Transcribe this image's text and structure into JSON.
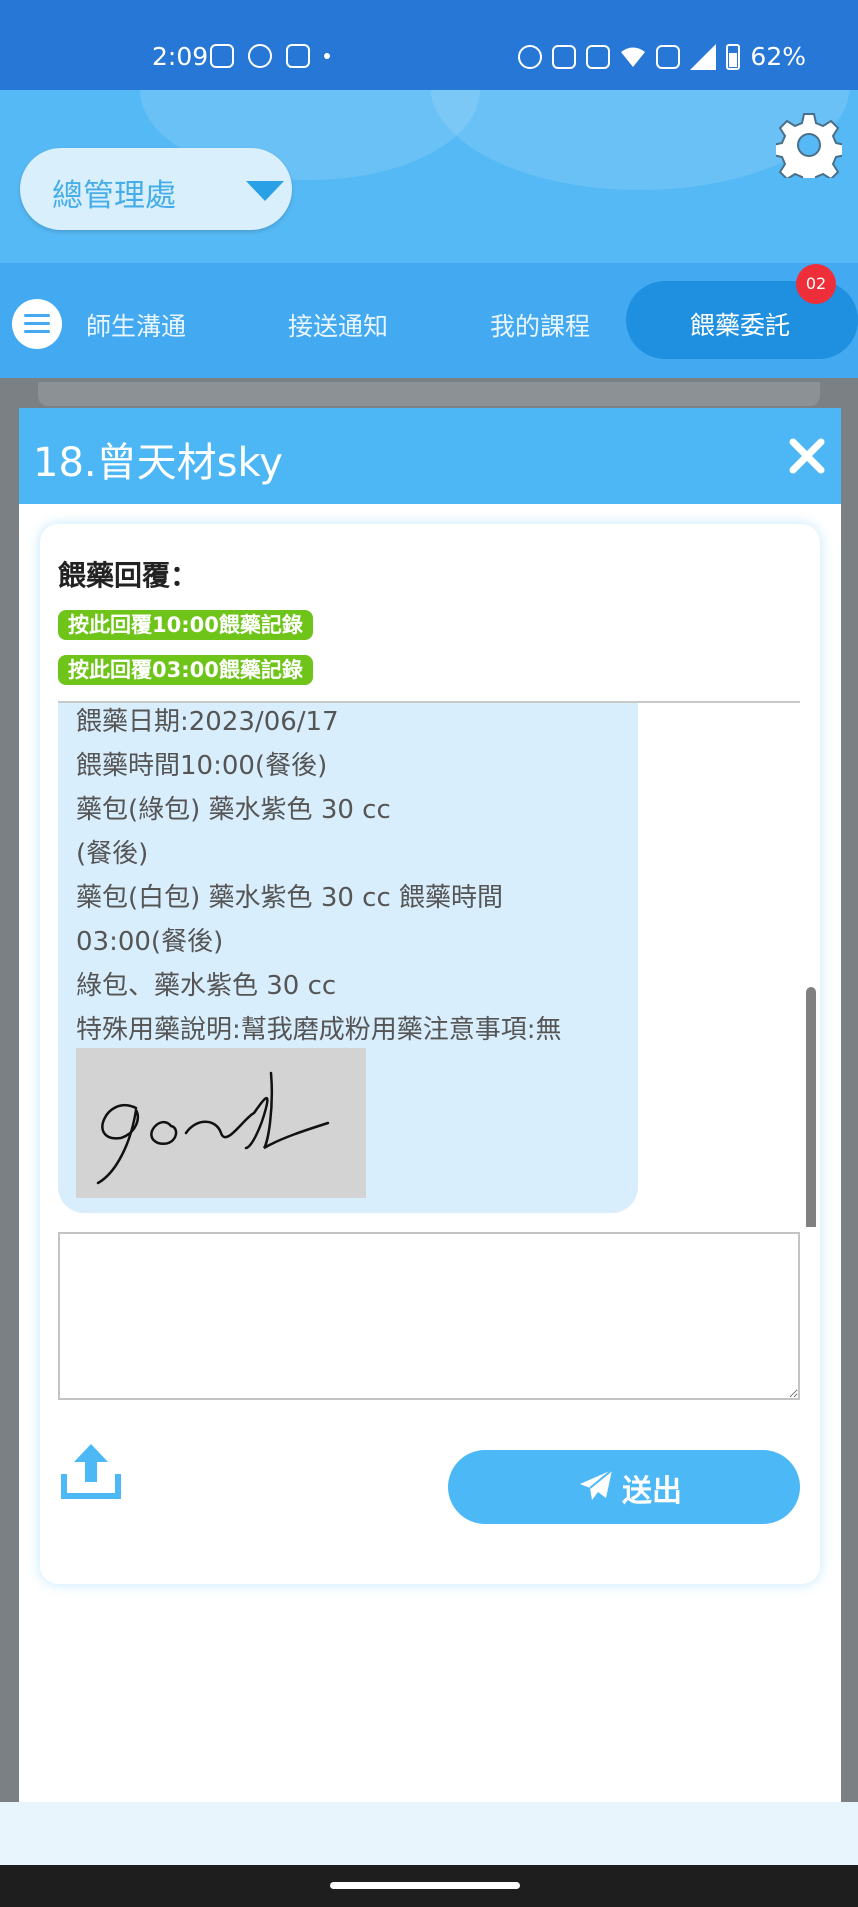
{
  "status_bar": {
    "time": "2:09",
    "battery": "62%",
    "icons": [
      "instagram-icon",
      "line-icon",
      "gallery-icon",
      "alarm-icon",
      "vibrate-icon",
      "wifi-icon",
      "volte-icon",
      "signal-icon",
      "battery-icon"
    ]
  },
  "header": {
    "branch": "總管理處",
    "settings_icon": "gear-icon"
  },
  "tabs": {
    "items": [
      "師生溝通",
      "接送通知",
      "我的課程",
      "餵藥委託"
    ],
    "active": "餵藥委託",
    "badge": "02"
  },
  "modal": {
    "title": "18.曾天材sky",
    "reply_title": "餵藥回覆：",
    "reply_buttons": [
      "按此回覆10:00餵藥記錄",
      "按此回覆03:00餵藥記錄"
    ],
    "message": {
      "lines": [
        "餵藥日期:2023/06/17",
        "餵藥時間10:00(餐後)",
        "藥包(綠包) 藥水紫色 30 cc",
        "(餐後)",
        "藥包(白包) 藥水紫色 30 cc 餵藥時間",
        "03:00(餐後)",
        "綠包、藥水紫色 30 cc",
        "特殊用藥說明:幫我磨成粉用藥注意事項:無"
      ]
    },
    "input_value": "",
    "send_label": "送出"
  },
  "colors": {
    "status_bar": "#2778d6",
    "header": "#55b9f5",
    "tabbar": "#43a9f1",
    "modal_header": "#4db6f4",
    "reply_button": "#6fc41a",
    "bubble": "#d9eefc",
    "send_button": "#4cb8f6",
    "badge": "#ee2f39"
  }
}
